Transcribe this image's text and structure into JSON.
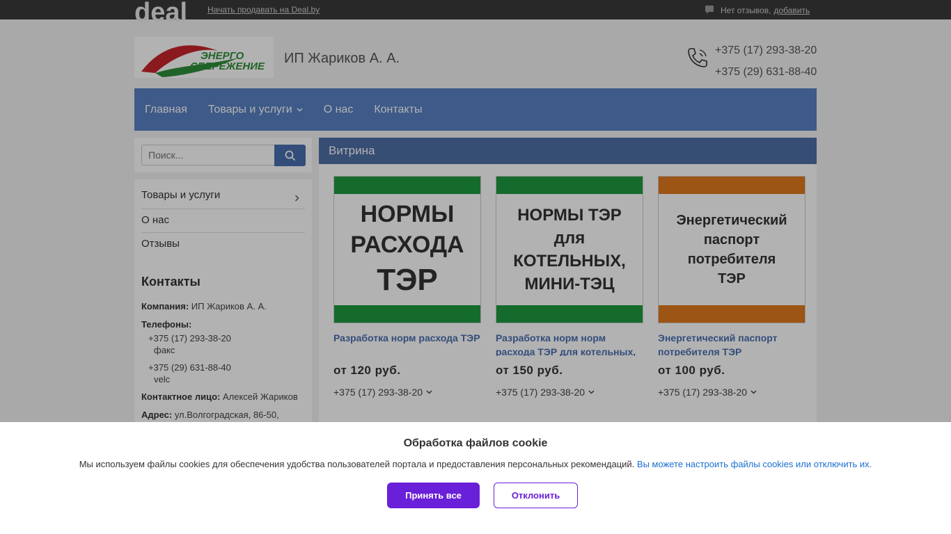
{
  "topbar": {
    "logo_text": "deal",
    "sell_link": "Начать продавать на Deal.by",
    "reviews_text": "Нет отзывов,",
    "reviews_add": "добавить"
  },
  "header": {
    "logo_alt": "ЭНЕРГО СБЕРЕЖЕНИЕ",
    "company_name": "ИП Жариков А. А.",
    "phones": [
      "+375 (17) 293-38-20",
      "+375 (29) 631-88-40"
    ]
  },
  "nav": {
    "items": [
      "Главная",
      "Товары и услуги",
      "О нас",
      "Контакты"
    ]
  },
  "search": {
    "placeholder": "Поиск..."
  },
  "sidebar": {
    "menu": [
      "Товары и услуги",
      "О нас",
      "Отзывы"
    ],
    "contacts_title": "Контакты",
    "company_label": "Компания:",
    "company_value": "ИП Жариков А. А.",
    "phones_label": "Телефоны:",
    "phone1": "+375 (17) 293-38-20",
    "phone1_note": "факс",
    "phone2": "+375 (29) 631-88-40",
    "phone2_note": "velc",
    "contact_label": "Контактное лицо:",
    "contact_value": "Алексей Жариков",
    "address_label": "Адрес:",
    "address_value": "ул.Волгоградская, 86-50,"
  },
  "showcase": {
    "title": "Витрина",
    "cards": [
      {
        "image_lines": [
          "НОРМЫ",
          "РАСХОДА",
          "ТЭР"
        ],
        "stripe_color": "#1f9a3f",
        "title": "Разработка норм расхода ТЭР",
        "price": "от 120 руб.",
        "phone": "+375 (17) 293-38-20"
      },
      {
        "image_lines": [
          "НОРМЫ ТЭР",
          "для",
          "КОТЕЛЬНЫХ,",
          "МИНИ-ТЭЦ"
        ],
        "stripe_color": "#1f9a3f",
        "title": "Разработка норм норм расхода ТЭР для котельных,",
        "price": "от 150 руб.",
        "phone": "+375 (17) 293-38-20"
      },
      {
        "image_lines": [
          "Энергетический",
          "паспорт",
          "потребителя",
          "ТЭР"
        ],
        "stripe_color": "#e07a1f",
        "title": "Энергетический паспорт потребителя ТЭР",
        "price": "от 100 руб.",
        "phone": "+375 (17) 293-38-20"
      }
    ]
  },
  "cookie": {
    "title": "Обработка файлов cookie",
    "text": "Мы используем файлы cookies для обеспечения удобства пользователей портала и предоставления персональных рекомендаций.",
    "link": "Вы можете настроить файлы cookies или отключить их.",
    "accept": "Принять все",
    "decline": "Отклонить"
  },
  "colors": {
    "nav_bg": "#5a81c4",
    "accent_purple": "#6a1fd8",
    "link_blue": "#4a6faf"
  }
}
